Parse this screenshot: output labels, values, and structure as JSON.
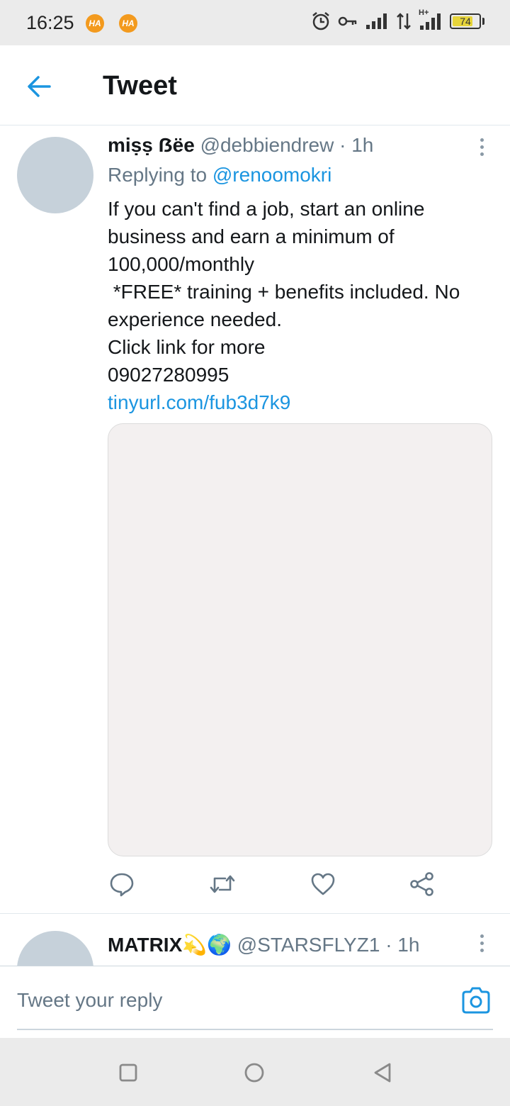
{
  "status_bar": {
    "time": "16:25",
    "notification_badges": [
      "HA",
      "HA"
    ],
    "battery_level": "74",
    "network_type": "H+",
    "icons": [
      "alarm-icon",
      "key-icon",
      "signal-icon",
      "data-transfer-icon",
      "signal-icon",
      "battery-icon"
    ]
  },
  "header": {
    "title": "Tweet",
    "back_icon": "arrow-left-icon"
  },
  "colors": {
    "accent": "#1b95e0",
    "text_primary": "#14171a",
    "text_secondary": "#657786",
    "avatar_placeholder": "#c6d1da",
    "media_placeholder": "#f3f0f0"
  },
  "tweets": [
    {
      "author_name": "miṣṣ ẞëe",
      "handle": "@debbiendrew",
      "time": "· 1h",
      "replying_prefix": "Replying to",
      "replying_to": "@renoomokri",
      "text_lines": [
        "If you can't find a job, start an online",
        "business and earn a minimum of",
        "100,000/monthly",
        " *FREE* training + benefits included. No",
        "experience needed.",
        "Click link for more",
        "09027280995"
      ],
      "url": "tinyurl.com/fub3d7k9",
      "actions": [
        "reply-icon",
        "retweet-icon",
        "like-icon",
        "share-icon"
      ]
    },
    {
      "author_name": "MATRIX💫🌍",
      "handle": "@STARSFLYZ1",
      "time": "· 1h"
    }
  ],
  "reply_bar": {
    "placeholder": "Tweet your reply",
    "camera_icon": "camera-icon"
  },
  "nav_bar": {
    "buttons": [
      "recents-square-icon",
      "home-circle-icon",
      "back-triangle-icon"
    ]
  }
}
